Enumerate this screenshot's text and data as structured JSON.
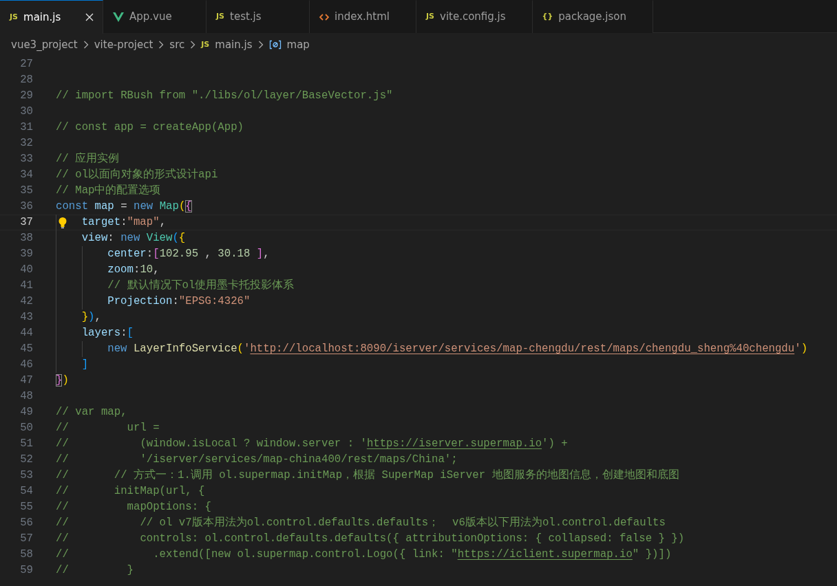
{
  "tabs": [
    {
      "label": "main.js",
      "kind": "js",
      "badge": "JS",
      "selected": true
    },
    {
      "label": "App.vue",
      "kind": "vue",
      "selected": false
    },
    {
      "label": "test.js",
      "kind": "js",
      "badge": "JS",
      "selected": false
    },
    {
      "label": "index.html",
      "kind": "html",
      "selected": false
    },
    {
      "label": "vite.config.js",
      "kind": "js",
      "badge": "JS",
      "selected": false
    },
    {
      "label": "package.json",
      "kind": "json",
      "badge": "{}",
      "selected": false
    }
  ],
  "breadcrumbs": [
    {
      "label": "vue3_project",
      "kind": "folder"
    },
    {
      "label": "vite-project",
      "kind": "folder"
    },
    {
      "label": "src",
      "kind": "folder"
    },
    {
      "label": "main.js",
      "kind": "file",
      "badge": "JS"
    },
    {
      "label": "map",
      "kind": "symbol"
    }
  ],
  "lines": [
    {
      "number": "27"
    },
    {
      "number": "28"
    },
    {
      "number": "29",
      "tokens": [
        {
          "text": "// import RBush from \"./libs/ol/layer/BaseVector.js\"",
          "kind": "comment"
        }
      ]
    },
    {
      "number": "30"
    },
    {
      "number": "31",
      "tokens": [
        {
          "text": "// const app = createApp(App)",
          "kind": "comment"
        }
      ]
    },
    {
      "number": "32"
    },
    {
      "number": "33",
      "tokens": [
        {
          "text": "// 应用实例",
          "kind": "comment"
        }
      ]
    },
    {
      "number": "34",
      "tokens": [
        {
          "text": "// ol以面向对象的形式设计api",
          "kind": "comment"
        }
      ]
    },
    {
      "number": "35",
      "tokens": [
        {
          "text": "// Map中的配置选项",
          "kind": "comment"
        }
      ]
    },
    {
      "number": "36",
      "tokens": [
        {
          "text": "const ",
          "kind": "keyword"
        },
        {
          "text": "map",
          "kind": "variable"
        },
        {
          "text": " = ",
          "kind": "plain"
        },
        {
          "text": "new ",
          "kind": "keyword"
        },
        {
          "text": "Map",
          "kind": "class"
        },
        {
          "text": "(",
          "kind": "bracket1"
        },
        {
          "text": "{",
          "kind": "bracket2",
          "matched": true
        }
      ]
    },
    {
      "number": "37",
      "current": true,
      "lightbulb": true,
      "kind": "level1",
      "tokens": [
        {
          "text": "target",
          "kind": "property"
        },
        {
          "text": ":",
          "kind": "plain"
        },
        {
          "text": "\"map\"",
          "kind": "string"
        },
        {
          "text": ",",
          "kind": "plain"
        }
      ]
    },
    {
      "number": "38",
      "kind": "level1",
      "tokens": [
        {
          "text": "view",
          "kind": "property"
        },
        {
          "text": ": ",
          "kind": "plain"
        },
        {
          "text": "new ",
          "kind": "keyword"
        },
        {
          "text": "View",
          "kind": "class"
        },
        {
          "text": "(",
          "kind": "bracket3"
        },
        {
          "text": "{",
          "kind": "bracket1"
        }
      ]
    },
    {
      "number": "39",
      "kind": "level2",
      "tokens": [
        {
          "text": "center",
          "kind": "property"
        },
        {
          "text": ":",
          "kind": "plain"
        },
        {
          "text": "[",
          "kind": "bracket2"
        },
        {
          "text": "102.95",
          "kind": "number"
        },
        {
          "text": " , ",
          "kind": "plain"
        },
        {
          "text": "30.18",
          "kind": "number"
        },
        {
          "text": " ]",
          "kind": "bracket2"
        },
        {
          "text": ",",
          "kind": "plain"
        }
      ]
    },
    {
      "number": "40",
      "kind": "level2",
      "tokens": [
        {
          "text": "zoom",
          "kind": "property"
        },
        {
          "text": ":",
          "kind": "plain"
        },
        {
          "text": "10",
          "kind": "number"
        },
        {
          "text": ",",
          "kind": "plain"
        }
      ]
    },
    {
      "number": "41",
      "kind": "level2",
      "tokens": [
        {
          "text": "// 默认情况下ol使用墨卡托投影体系",
          "kind": "comment"
        }
      ]
    },
    {
      "number": "42",
      "kind": "level2",
      "tokens": [
        {
          "text": "Projection",
          "kind": "property"
        },
        {
          "text": ":",
          "kind": "plain"
        },
        {
          "text": "\"EPSG:4326\"",
          "kind": "string"
        }
      ]
    },
    {
      "number": "43",
      "kind": "level1",
      "tokens": [
        {
          "text": "}",
          "kind": "bracket1"
        },
        {
          "text": ")",
          "kind": "bracket3"
        },
        {
          "text": ",",
          "kind": "plain"
        }
      ]
    },
    {
      "number": "44",
      "kind": "level1",
      "tokens": [
        {
          "text": "layers",
          "kind": "property"
        },
        {
          "text": ":",
          "kind": "plain"
        },
        {
          "text": "[",
          "kind": "bracket3"
        }
      ]
    },
    {
      "number": "45",
      "kind": "level2",
      "tokens": [
        {
          "text": "new ",
          "kind": "keyword"
        },
        {
          "text": "LayerInfoService",
          "kind": "function"
        },
        {
          "text": "(",
          "kind": "bracket1"
        },
        {
          "text": "'",
          "kind": "string"
        },
        {
          "text": "http://localhost:8090/iserver/services/map-chengdu/rest/maps/chengdu_sheng%40chengdu",
          "kind": "string_link"
        },
        {
          "text": "'",
          "kind": "string"
        },
        {
          "text": ")",
          "kind": "bracket1"
        }
      ]
    },
    {
      "number": "46",
      "kind": "level1",
      "tokens": [
        {
          "text": "]",
          "kind": "bracket3"
        }
      ]
    },
    {
      "number": "47",
      "tokens": [
        {
          "text": "}",
          "kind": "bracket2",
          "matched": true
        },
        {
          "text": ")",
          "kind": "bracket1"
        }
      ]
    },
    {
      "number": "48"
    },
    {
      "number": "49",
      "tokens": [
        {
          "text": "// var map,",
          "kind": "comment"
        }
      ]
    },
    {
      "number": "50",
      "tokens": [
        {
          "text": "//         url =",
          "kind": "comment"
        }
      ]
    },
    {
      "number": "51",
      "tokens": [
        {
          "text": "//           (window.isLocal ? window.server : '",
          "kind": "comment"
        },
        {
          "text": "https://iserver.supermap.io",
          "kind": "comment_link"
        },
        {
          "text": "') +",
          "kind": "comment"
        }
      ]
    },
    {
      "number": "52",
      "tokens": [
        {
          "text": "//           '/iserver/services/map-china400/rest/maps/China';",
          "kind": "comment"
        }
      ]
    },
    {
      "number": "53",
      "tokens": [
        {
          "text": "//       // 方式一：1.调用 ol.supermap.initMap，根据 SuperMap iServer 地图服务的地图信息，创建地图和底图",
          "kind": "comment"
        }
      ]
    },
    {
      "number": "54",
      "tokens": [
        {
          "text": "//       initMap(url, {",
          "kind": "comment"
        }
      ]
    },
    {
      "number": "55",
      "tokens": [
        {
          "text": "//         mapOptions: {",
          "kind": "comment"
        }
      ]
    },
    {
      "number": "56",
      "tokens": [
        {
          "text": "//           // ol v7版本用法为ol.control.defaults.defaults；  v6版本以下用法为ol.control.defaults",
          "kind": "comment"
        }
      ]
    },
    {
      "number": "57",
      "tokens": [
        {
          "text": "//           controls: ol.control.defaults.defaults({ attributionOptions: { collapsed: false } })",
          "kind": "comment"
        }
      ]
    },
    {
      "number": "58",
      "tokens": [
        {
          "text": "//             .extend([new ol.supermap.control.Logo({ link: \"",
          "kind": "comment"
        },
        {
          "text": "https://iclient.supermap.io",
          "kind": "comment_link"
        },
        {
          "text": "\" })])",
          "kind": "comment"
        }
      ]
    },
    {
      "number": "59",
      "tokens": [
        {
          "text": "//         }",
          "kind": "comment"
        }
      ]
    }
  ]
}
